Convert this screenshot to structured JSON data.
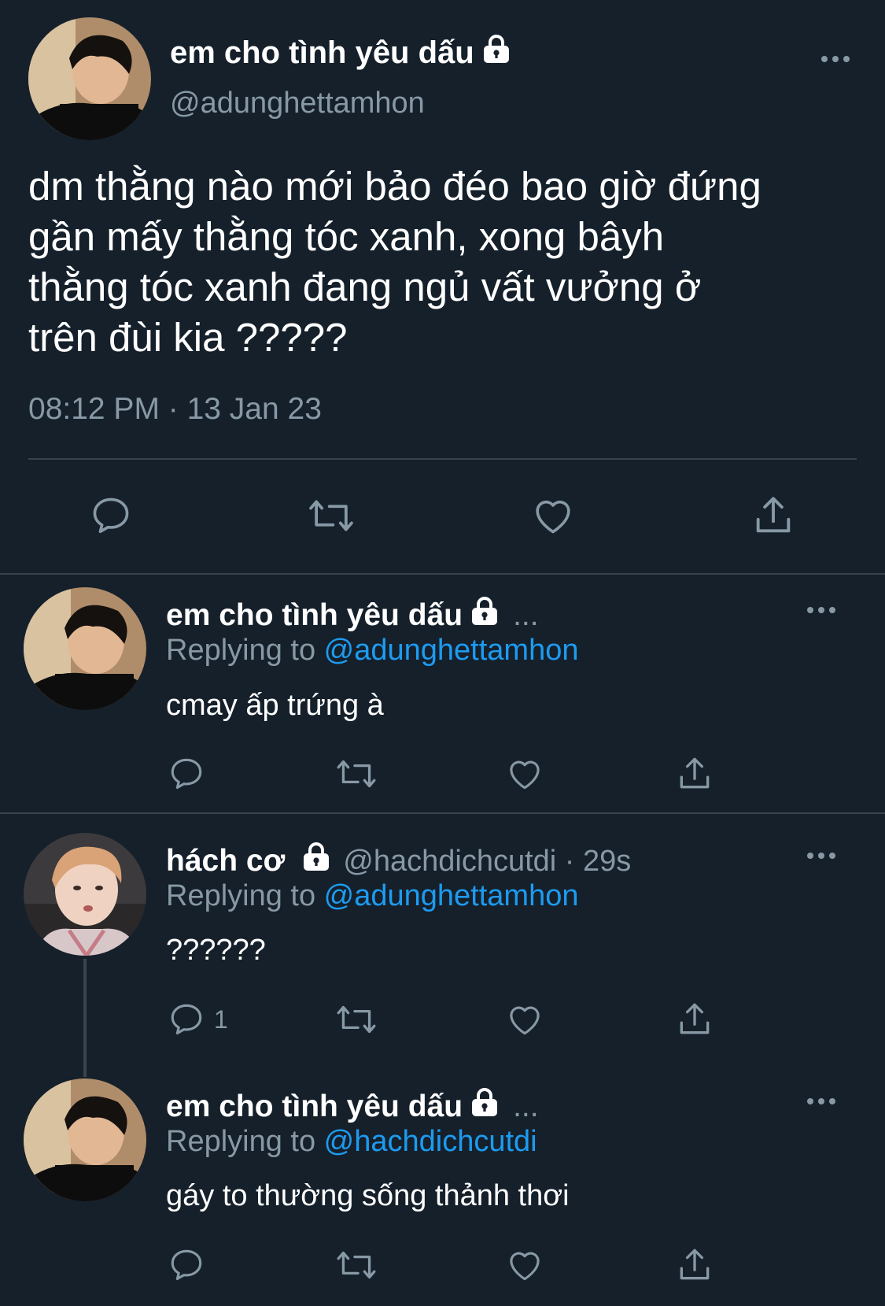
{
  "main_tweet": {
    "display_name": "em cho tình yêu dấu",
    "handle": "@adunghettamhon",
    "text_lines": [
      "dm thằng nào mới bảo đéo bao giờ đứng",
      "gần mấy thằng tóc xanh, xong bâyh",
      "thằng tóc xanh đang ngủ vất vưởng ở",
      "trên đùi kia ?????"
    ],
    "timestamp": "08:12 PM · 13 Jan 23",
    "icons": [
      "reply-icon",
      "retweet-icon",
      "like-icon",
      "share-icon"
    ]
  },
  "replies": [
    {
      "display_name": "em cho tình yêu dấu",
      "ellipsis": "...",
      "replying_prefix": "Replying to ",
      "replying_to": "@adunghettamhon",
      "text": "cmay ấp trứng à",
      "reply_count": ""
    },
    {
      "display_name": "hách cơ",
      "handle_time": "@hachdichcutdi · 29s",
      "replying_prefix": "Replying to ",
      "replying_to": "@adunghettamhon",
      "text": "??????",
      "reply_count": "1"
    },
    {
      "display_name": "em cho tình yêu dấu",
      "ellipsis": "...",
      "replying_prefix": "Replying to ",
      "replying_to": "@hachdichcutdi",
      "text": "gáy to thường sống thảnh thơi",
      "reply_count": ""
    }
  ],
  "colors": {
    "background": "#15202b",
    "text": "#ffffff",
    "muted": "#8899a6",
    "link": "#1d9bf0",
    "divider": "#38444d"
  }
}
